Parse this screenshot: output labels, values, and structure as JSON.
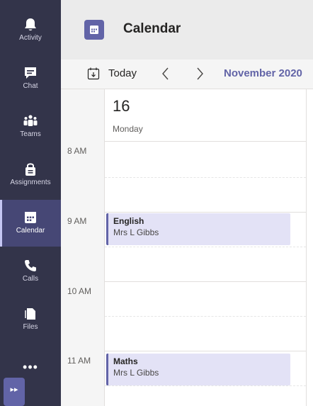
{
  "rail": {
    "items": [
      {
        "label": "Activity",
        "icon": "bell-icon"
      },
      {
        "label": "Chat",
        "icon": "chat-icon"
      },
      {
        "label": "Teams",
        "icon": "teams-icon"
      },
      {
        "label": "Assignments",
        "icon": "assignments-icon"
      },
      {
        "label": "Calendar",
        "icon": "calendar-icon",
        "active": true
      },
      {
        "label": "Calls",
        "icon": "phone-icon"
      },
      {
        "label": "Files",
        "icon": "files-icon"
      }
    ],
    "more_label": "•••",
    "apps_label": "▸▸"
  },
  "header": {
    "title": "Calendar",
    "icon": "calendar-icon"
  },
  "toolbar": {
    "today_label": "Today",
    "month_label": "November 2020"
  },
  "day": {
    "number": "16",
    "name": "Monday"
  },
  "hours": [
    "8 AM",
    "9 AM",
    "10 AM",
    "11 AM"
  ],
  "events": [
    {
      "title": "English",
      "organizer": "Mrs L Gibbs",
      "start": "9 AM"
    },
    {
      "title": "Maths",
      "organizer": "Mrs L Gibbs",
      "start": "11 AM"
    }
  ],
  "colors": {
    "rail_bg": "#33344a",
    "rail_active": "#464775",
    "accent": "#6264a7",
    "event_bg": "#e3e2f6"
  }
}
